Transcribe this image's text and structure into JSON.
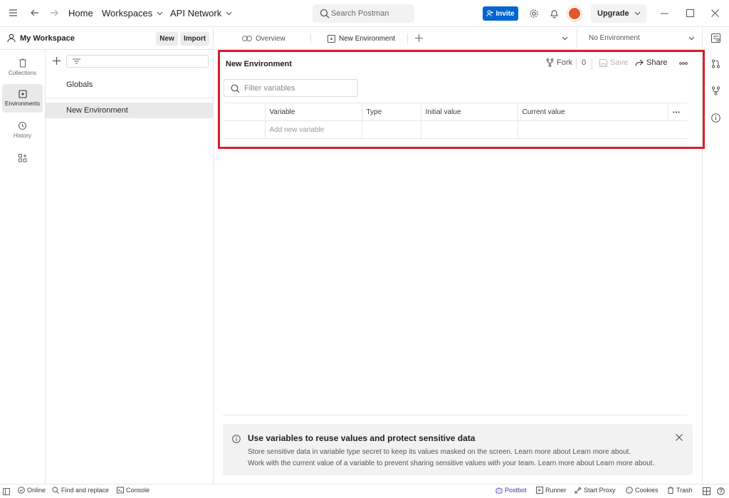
{
  "titlebar": {
    "home": "Home",
    "workspaces": "Workspaces",
    "api_network": "API Network",
    "search_placeholder": "Search Postman",
    "invite": "Invite",
    "upgrade": "Upgrade"
  },
  "workspace": {
    "name": "My Workspace",
    "new_btn": "New",
    "import_btn": "Import"
  },
  "leftrail": {
    "collections": "Collections",
    "environments": "Environments",
    "history": "History"
  },
  "sidebar": {
    "items": [
      {
        "label": "Globals",
        "active": false
      },
      {
        "label": "New Environment",
        "active": true
      }
    ]
  },
  "tabs": {
    "overview": "Overview",
    "new_environment": "New Environment",
    "env_selector": "No Environment"
  },
  "editor": {
    "title": "New Environment",
    "fork": "Fork",
    "fork_count": "0",
    "save": "Save",
    "share": "Share",
    "filter_placeholder": "Filter variables",
    "columns": [
      "Variable",
      "Type",
      "Initial value",
      "Current value"
    ],
    "add_new_placeholder": "Add new variable"
  },
  "banner": {
    "title": "Use variables to reuse values and protect sensitive data",
    "line1": "Store sensitive data in variable type secret to keep its values masked on the screen. Learn more about Learn more about.",
    "line2": "Work with the current value of a variable to prevent sharing sensitive values with your team. Learn more about Learn more about."
  },
  "statusbar": {
    "online": "Online",
    "find_replace": "Find and replace",
    "console": "Console",
    "postbot": "Postbot",
    "runner": "Runner",
    "start_proxy": "Start Proxy",
    "cookies": "Cookies",
    "trash": "Trash"
  },
  "colors": {
    "accent_blue": "#0265d2",
    "highlight_red": "#d81e2a",
    "avatar_orange": "#e05a2b",
    "postbot_purple": "#6b4fbb"
  }
}
